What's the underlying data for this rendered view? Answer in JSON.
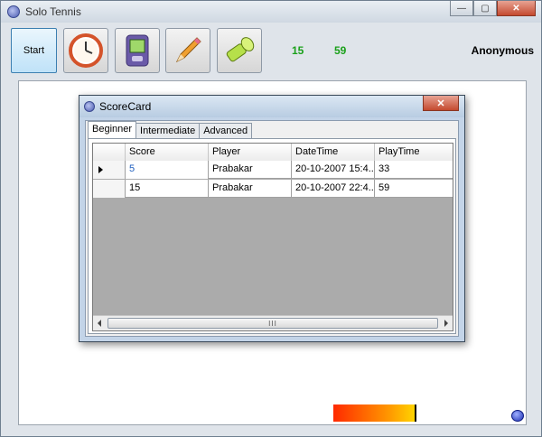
{
  "window": {
    "title": "Solo Tennis",
    "controls": {
      "minimize": "—",
      "maximize": "▢",
      "close": "✕"
    }
  },
  "toolbar": {
    "start_label": "Start",
    "tools": [
      {
        "icon": "clock-icon"
      },
      {
        "icon": "handheld-device-icon"
      },
      {
        "icon": "pencil-icon"
      },
      {
        "icon": "flashlight-icon"
      }
    ],
    "score": "15",
    "time": "59",
    "player": "Anonymous"
  },
  "power_level": 0.8,
  "scorecard": {
    "title": "ScoreCard",
    "close": "✕",
    "tabs": [
      "Beginner",
      "Intermediate",
      "Advanced"
    ],
    "active_tab": 0,
    "columns": [
      "Score",
      "Player",
      "DateTime",
      "PlayTime"
    ],
    "rows": [
      {
        "score": "5",
        "player": "Prabakar",
        "datetime": "20-10-2007 15:4...",
        "playtime": "33"
      },
      {
        "score": "15",
        "player": "Prabakar",
        "datetime": "20-10-2007 22:4...",
        "playtime": "59"
      }
    ],
    "scroll_grip": "III"
  },
  "colors": {
    "score_green": "#1aa01a",
    "grid_empty": "#ababab"
  }
}
